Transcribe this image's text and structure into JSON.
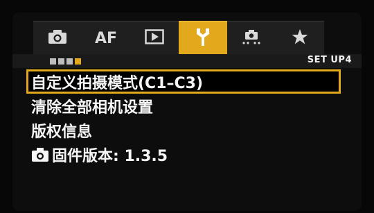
{
  "tabs": [
    {
      "id": "shooting",
      "icon": "camera-icon"
    },
    {
      "id": "af",
      "label": "AF"
    },
    {
      "id": "playback",
      "icon": "play-icon"
    },
    {
      "id": "setup",
      "icon": "wrench-icon",
      "active": true
    },
    {
      "id": "custom-functions",
      "icon": "custom-functions-icon"
    },
    {
      "id": "my-menu",
      "icon": "star-icon"
    }
  ],
  "page_indicator": {
    "count": 4,
    "current": 4
  },
  "page_label": "SET UP4",
  "menu": {
    "items": [
      {
        "label": "自定义拍摄模式(C1–C3)",
        "selected": true
      },
      {
        "label": "清除全部相机设置"
      },
      {
        "label": "版权信息"
      },
      {
        "label": "固件版本: 1.3.5",
        "icon": "camera-icon"
      }
    ]
  },
  "colors": {
    "accent": "#e3a91d",
    "background": "#0d0d0d",
    "text": "#f6f6f6"
  }
}
